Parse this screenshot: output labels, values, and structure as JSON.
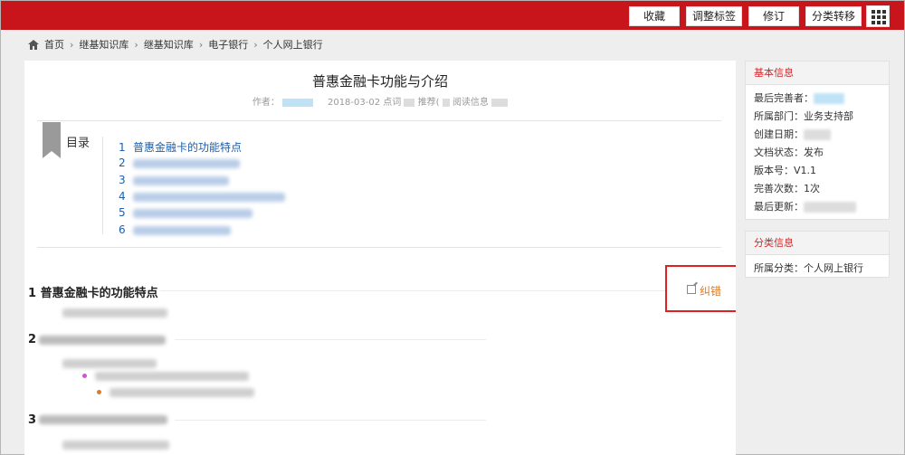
{
  "toolbar": {
    "favorite": "收藏",
    "adjust_tags": "调整标签",
    "revise": "修订",
    "reclassify": "分类转移"
  },
  "breadcrumb": [
    "首页",
    "继基知识库",
    "继基知识库",
    "电子银行",
    "个人网上银行"
  ],
  "article": {
    "title": "普惠金融卡功能与介绍",
    "author_label": "作者：",
    "date": "2018-03-02",
    "click_label": "点词",
    "recommend_label": "推荐(",
    "read_label": "阅读信息"
  },
  "toc": {
    "label": "目录",
    "items": [
      {
        "num": "1",
        "text": "普惠金融卡的功能特点"
      },
      {
        "num": "2",
        "text": ""
      },
      {
        "num": "3",
        "text": ""
      },
      {
        "num": "4",
        "text": ""
      },
      {
        "num": "5",
        "text": ""
      },
      {
        "num": "6",
        "text": ""
      }
    ]
  },
  "sections": [
    {
      "num": "1",
      "title": "普惠金融卡的功能特点"
    },
    {
      "num": "2",
      "title": ""
    },
    {
      "num": "3",
      "title": ""
    }
  ],
  "edit_link": "纠错",
  "basic_info": {
    "header": "基本信息",
    "last_editor_label": "最后完善者：",
    "department_label": "所属部门：",
    "department": "业务支持部",
    "created_label": "创建日期：",
    "status_label": "文档状态：",
    "status": "发布",
    "version_label": "版本号：",
    "version": "V1.1",
    "edit_count_label": "完善次数：",
    "edit_count": "1次",
    "last_update_label": "最后更新："
  },
  "category_info": {
    "header": "分类信息",
    "category_label": "所属分类：",
    "category": "个人网上银行"
  },
  "colors": {
    "brand_red": "#c8141b",
    "link_blue": "#1a5fae",
    "edit_orange": "#e07a20",
    "highlight_box": "#e02020"
  }
}
